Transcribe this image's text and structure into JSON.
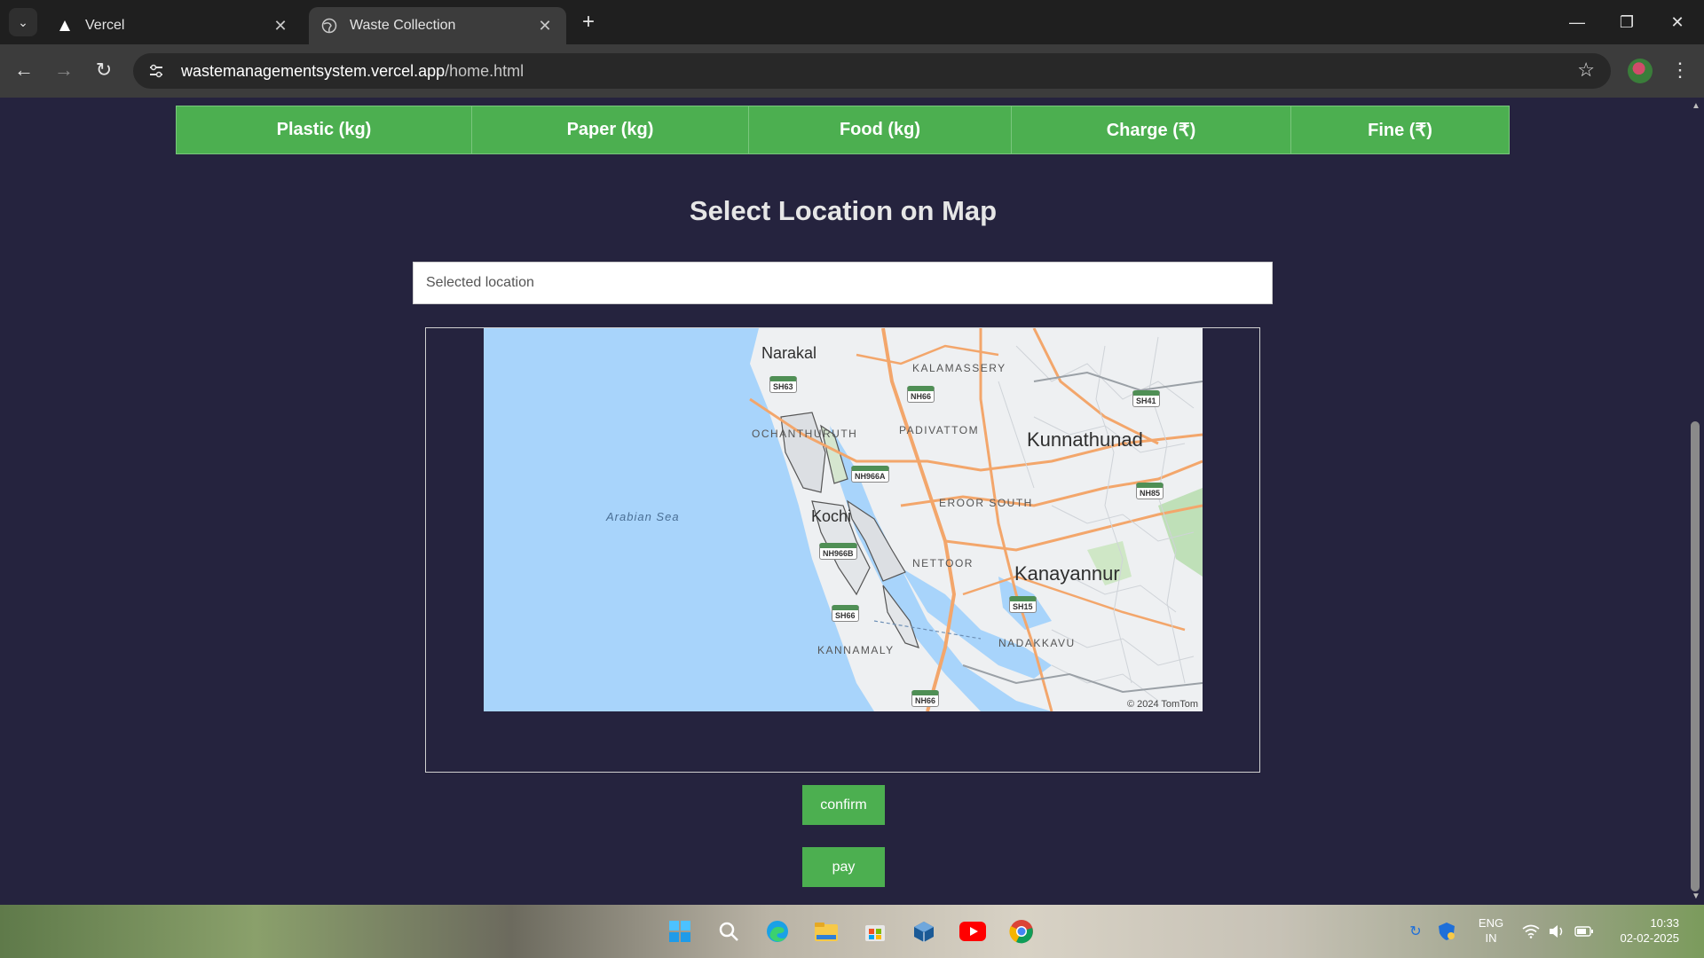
{
  "browser": {
    "tabs": [
      {
        "title": "Vercel",
        "active": false,
        "icon": "vercel-triangle-icon"
      },
      {
        "title": "Waste Collection",
        "active": true,
        "icon": "globe-icon"
      }
    ],
    "url_host": "wastemanagementsystem.vercel.app",
    "url_path": "/home.html"
  },
  "table": {
    "headers": [
      "Plastic (kg)",
      "Paper (kg)",
      "Food (kg)",
      "Charge (₹)",
      "Fine (₹)"
    ]
  },
  "heading": "Select Location on Map",
  "location_input": {
    "placeholder": "Selected location",
    "value": ""
  },
  "map": {
    "labels": {
      "narakal": "Narakal",
      "kalamassery": "KALAMASSERY",
      "ochanthuruth": "OCHANTHURUTH",
      "padivattom": "PADIVATTOM",
      "kunnathunad": "Kunnathunad",
      "arabian_sea": "Arabian Sea",
      "kochi": "Kochi",
      "eroor_south": "EROOR SOUTH",
      "nettoor": "NETTOOR",
      "kanayannur": "Kanayannur",
      "nadakkavu": "NADAKKAVU",
      "kannamaly": "KANNAMALY"
    },
    "shields": {
      "sh63": "SH63",
      "nh66_top": "NH66",
      "sh41": "SH41",
      "nh966a": "NH966A",
      "nh85": "NH85",
      "nh966b": "NH966B",
      "sh15": "SH15",
      "sh66": "SH66",
      "nh66_bottom": "NH66"
    },
    "attribution": "© 2024 TomTom",
    "colors": {
      "sea": "#a8d4fb",
      "land": "#eef0f2",
      "roads": "#f3a66b",
      "accent": "#4caf50"
    }
  },
  "buttons": {
    "confirm": "confirm",
    "pay": "pay"
  },
  "taskbar": {
    "apps": [
      "windows-start-icon",
      "search-icon",
      "edge-icon",
      "file-explorer-icon",
      "store-icon",
      "virtualbox-icon",
      "youtube-icon",
      "chrome-icon"
    ],
    "lang_top": "ENG",
    "lang_bottom": "IN",
    "time": "10:33",
    "date": "02-02-2025"
  }
}
